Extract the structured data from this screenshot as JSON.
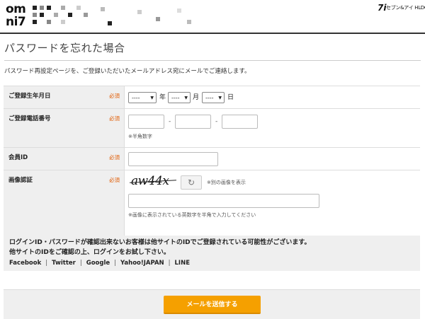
{
  "header": {
    "logo_line1": "om",
    "logo_line2": "ni7",
    "brand_mark": "7i",
    "brand_name": "セブン&アイ HLDGS."
  },
  "page": {
    "title": "パスワードを忘れた場合",
    "intro": "パスワード再設定ページを、ご登録いただいたメールアドレス宛にメールでご連絡します。"
  },
  "form": {
    "required_label": "必須",
    "birthdate": {
      "label": "ご登録生年月日",
      "year_value": "----",
      "month_value": "----",
      "day_value": "----",
      "year_unit": "年",
      "month_unit": "月",
      "day_unit": "日"
    },
    "phone": {
      "label": "ご登録電話番号",
      "separator": "-",
      "note": "※半角数字"
    },
    "member_id": {
      "label": "会員ID"
    },
    "captcha": {
      "label": "画像認証",
      "image_text": "aw44x",
      "refresh_icon": "refresh-icon",
      "other_image_link": "※別の画像を表示",
      "note": "※画像に表示されている英数字を半角で入力してください"
    }
  },
  "info": {
    "line1": "ログインID・パスワードが確認出来ないお客様は他サイトのIDでご登録されている可能性がございます。",
    "line2": "他サイトのIDをご確認の上、ログインをお試し下さい。",
    "links": [
      "Facebook",
      "Twitter",
      "Google",
      "Yahoo!JAPAN",
      "LINE"
    ],
    "link_separator": "|"
  },
  "submit": {
    "label": "メールを送信する"
  },
  "colors": {
    "accent": "#f5a000",
    "required": "#e05a00",
    "label_bg": "#efefef"
  }
}
